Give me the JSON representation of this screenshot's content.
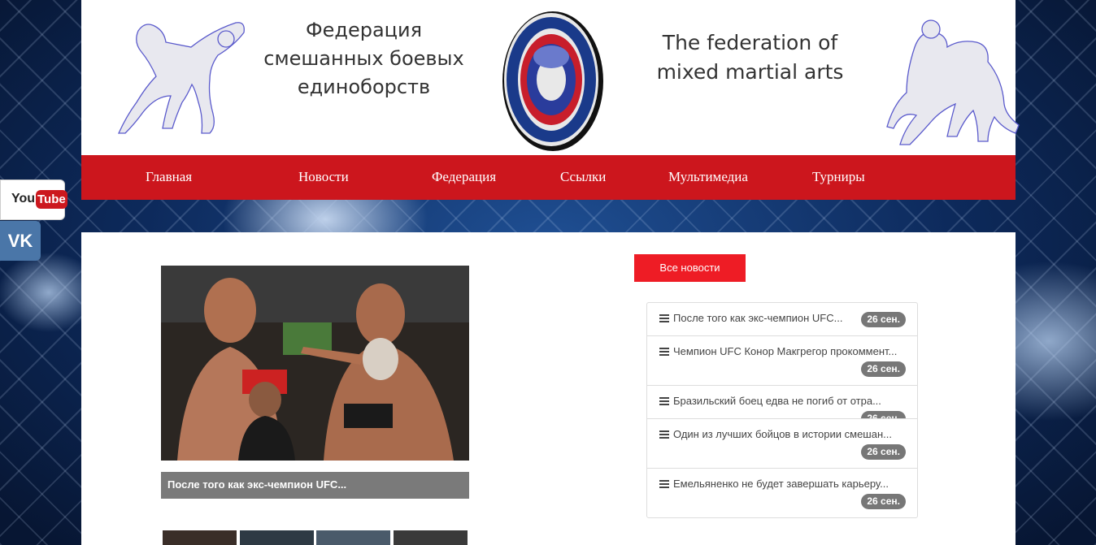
{
  "header": {
    "title_ru": "Федерация смешанных боевых единоборств",
    "title_en": "The federation of mixed martial arts"
  },
  "nav": {
    "items": [
      "Главная",
      "Новости",
      "Федерация",
      "Ссылки",
      "Мультимедиа",
      "Турниры"
    ]
  },
  "social": {
    "youtube_you": "You",
    "youtube_tube": "Tube",
    "vk": "VK"
  },
  "featured": {
    "caption": "После того как экс-чемпион UFC..."
  },
  "news": {
    "all_button": "Все новости",
    "items": [
      {
        "text": "После того как экс-чемпион UFC...",
        "date": "26 сен."
      },
      {
        "text": "Чемпион UFC Конор Макгрегор прокоммент...",
        "date": "26 сен."
      },
      {
        "text": "Бразильский боец едва не погиб от отра...",
        "date": "26 сен."
      },
      {
        "text": "Один из лучших бойцов в истории смешан...",
        "date": "26 сен."
      },
      {
        "text": "Емельяненко не будет завершать карьеру...",
        "date": "26 сен."
      }
    ]
  },
  "colors": {
    "nav_red": "#cc161d",
    "button_red": "#ee1c25",
    "badge_gray": "#777777"
  }
}
